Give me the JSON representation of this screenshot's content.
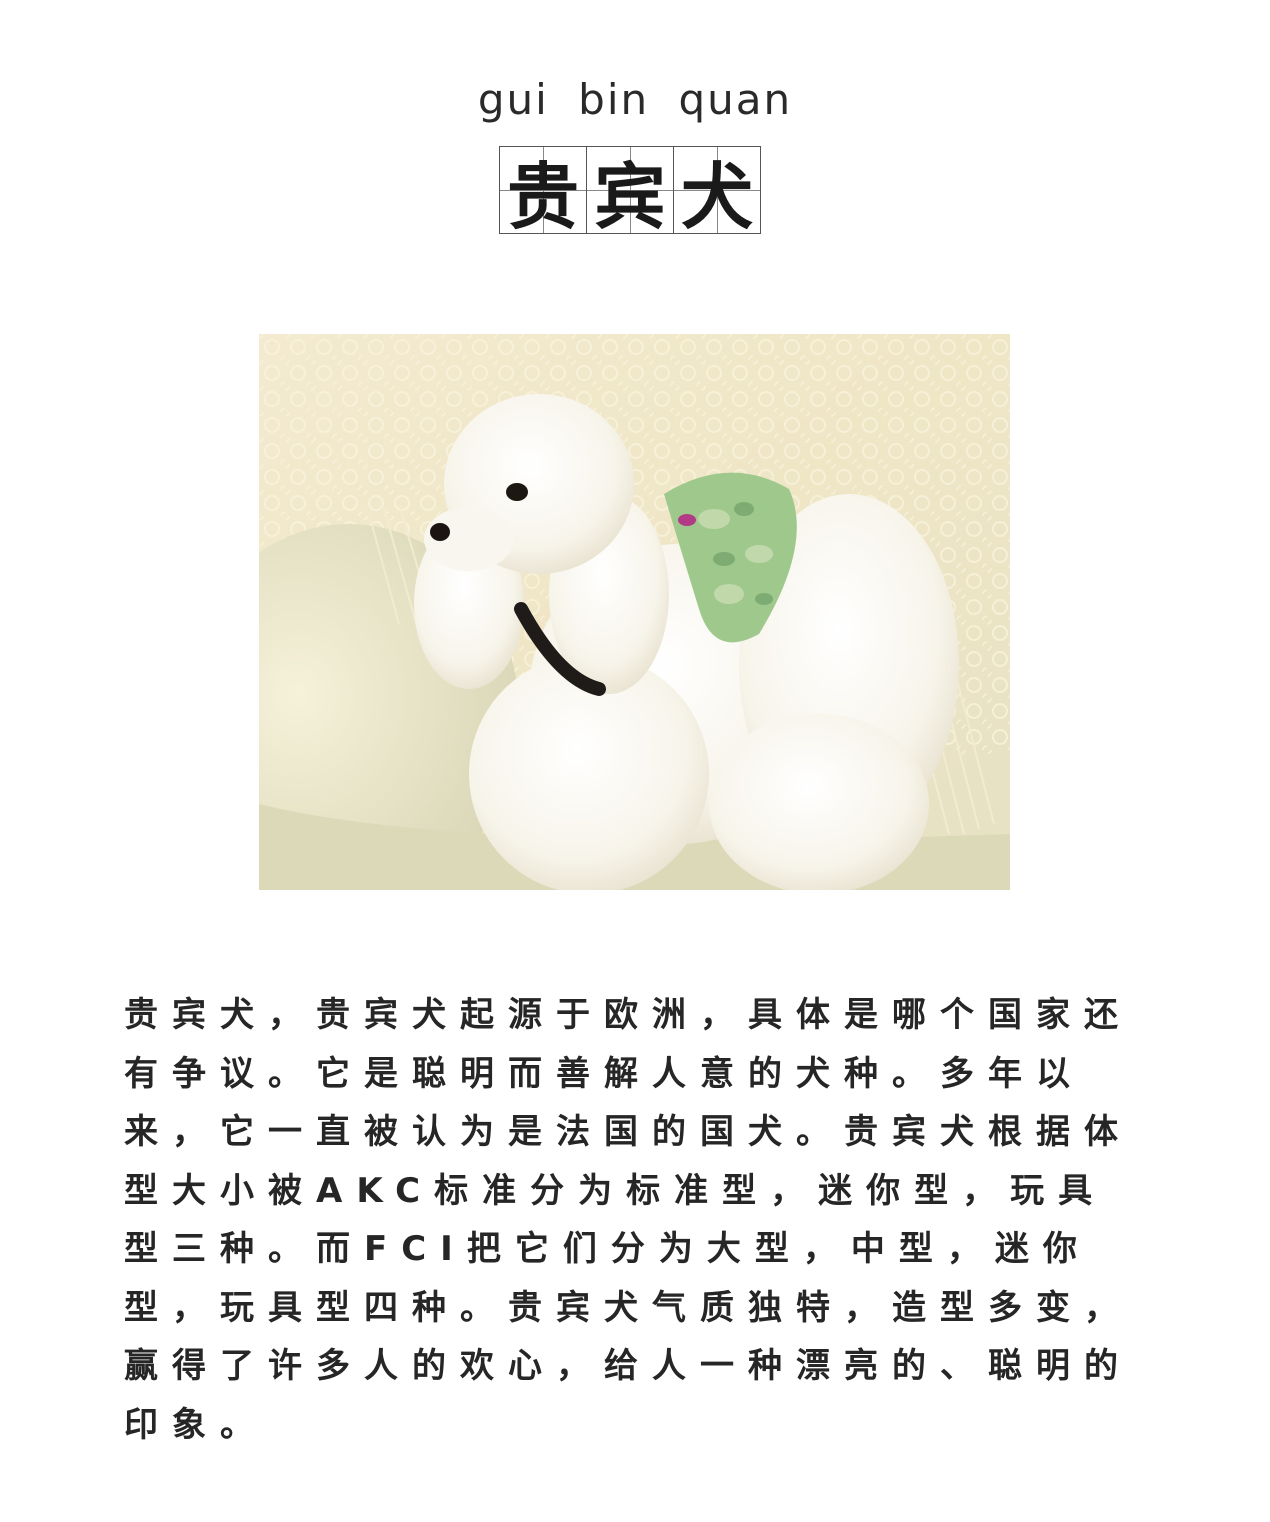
{
  "header": {
    "pinyin": "gui bin quan",
    "title_chars": [
      "贵",
      "宾",
      "犬"
    ]
  },
  "photo": {
    "subject": "white poodle wearing a green camouflage vest, sitting on a cream sofa with a lace throw"
  },
  "article": {
    "paragraph": "贵宾犬，贵宾犬起源于欧洲，具体是哪个国家还有争议。它是聪明而善解人意的犬种。多年以来，它一直被认为是法国的国犬。贵宾犬根据体型大小被AKC标准分为标准型，迷你型，玩具型三种。而FCI把它们分为大型，中型，迷你型，玩具型四种。贵宾犬气质独特，造型多变，赢得了许多人的欢心，给人一种漂亮的、聪明的印象。"
  },
  "colors": {
    "text": "#262626",
    "grid_line": "#555555",
    "background": "#ffffff"
  }
}
